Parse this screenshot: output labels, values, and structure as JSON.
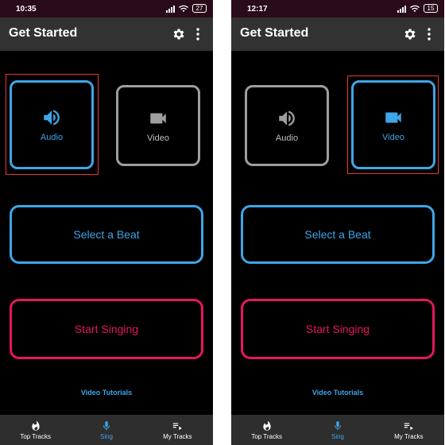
{
  "screens": [
    {
      "status": {
        "time": "10:35",
        "battery": "27"
      },
      "appbar": {
        "title": "Get Started"
      },
      "tiles": {
        "audio_label": "Audio",
        "video_label": "Video",
        "selected": "audio"
      },
      "buttons": {
        "select_beat": "Select a Beat",
        "start_singing": "Start Singing"
      },
      "tutorials": "Video Tutorials",
      "nav": {
        "top_tracks": "Top Tracks",
        "sing": "Sing",
        "my_tracks": "My Tracks"
      }
    },
    {
      "status": {
        "time": "12:17",
        "battery": "15"
      },
      "appbar": {
        "title": "Get Started"
      },
      "tiles": {
        "audio_label": "Audio",
        "video_label": "Video",
        "selected": "video"
      },
      "buttons": {
        "select_beat": "Select a Beat",
        "start_singing": "Start Singing"
      },
      "tutorials": "Video Tutorials",
      "nav": {
        "top_tracks": "Top Tracks",
        "sing": "Sing",
        "my_tracks": "My Tracks"
      }
    }
  ],
  "colors": {
    "accent_blue": "#3ea6e8",
    "accent_pink": "#e5165e",
    "highlight_red": "#e53935",
    "inactive_gray": "#9e9e9e",
    "status_bar": "#2a0b1b",
    "app_bar": "#323232",
    "bottom_nav": "#2e2e2e"
  },
  "icons": {
    "audio": "speaker-icon",
    "video": "video-camera-icon",
    "settings": "gear-icon",
    "overflow": "more-vert-icon",
    "top_tracks": "flame-icon",
    "sing": "microphone-icon",
    "my_tracks": "playlist-icon"
  }
}
